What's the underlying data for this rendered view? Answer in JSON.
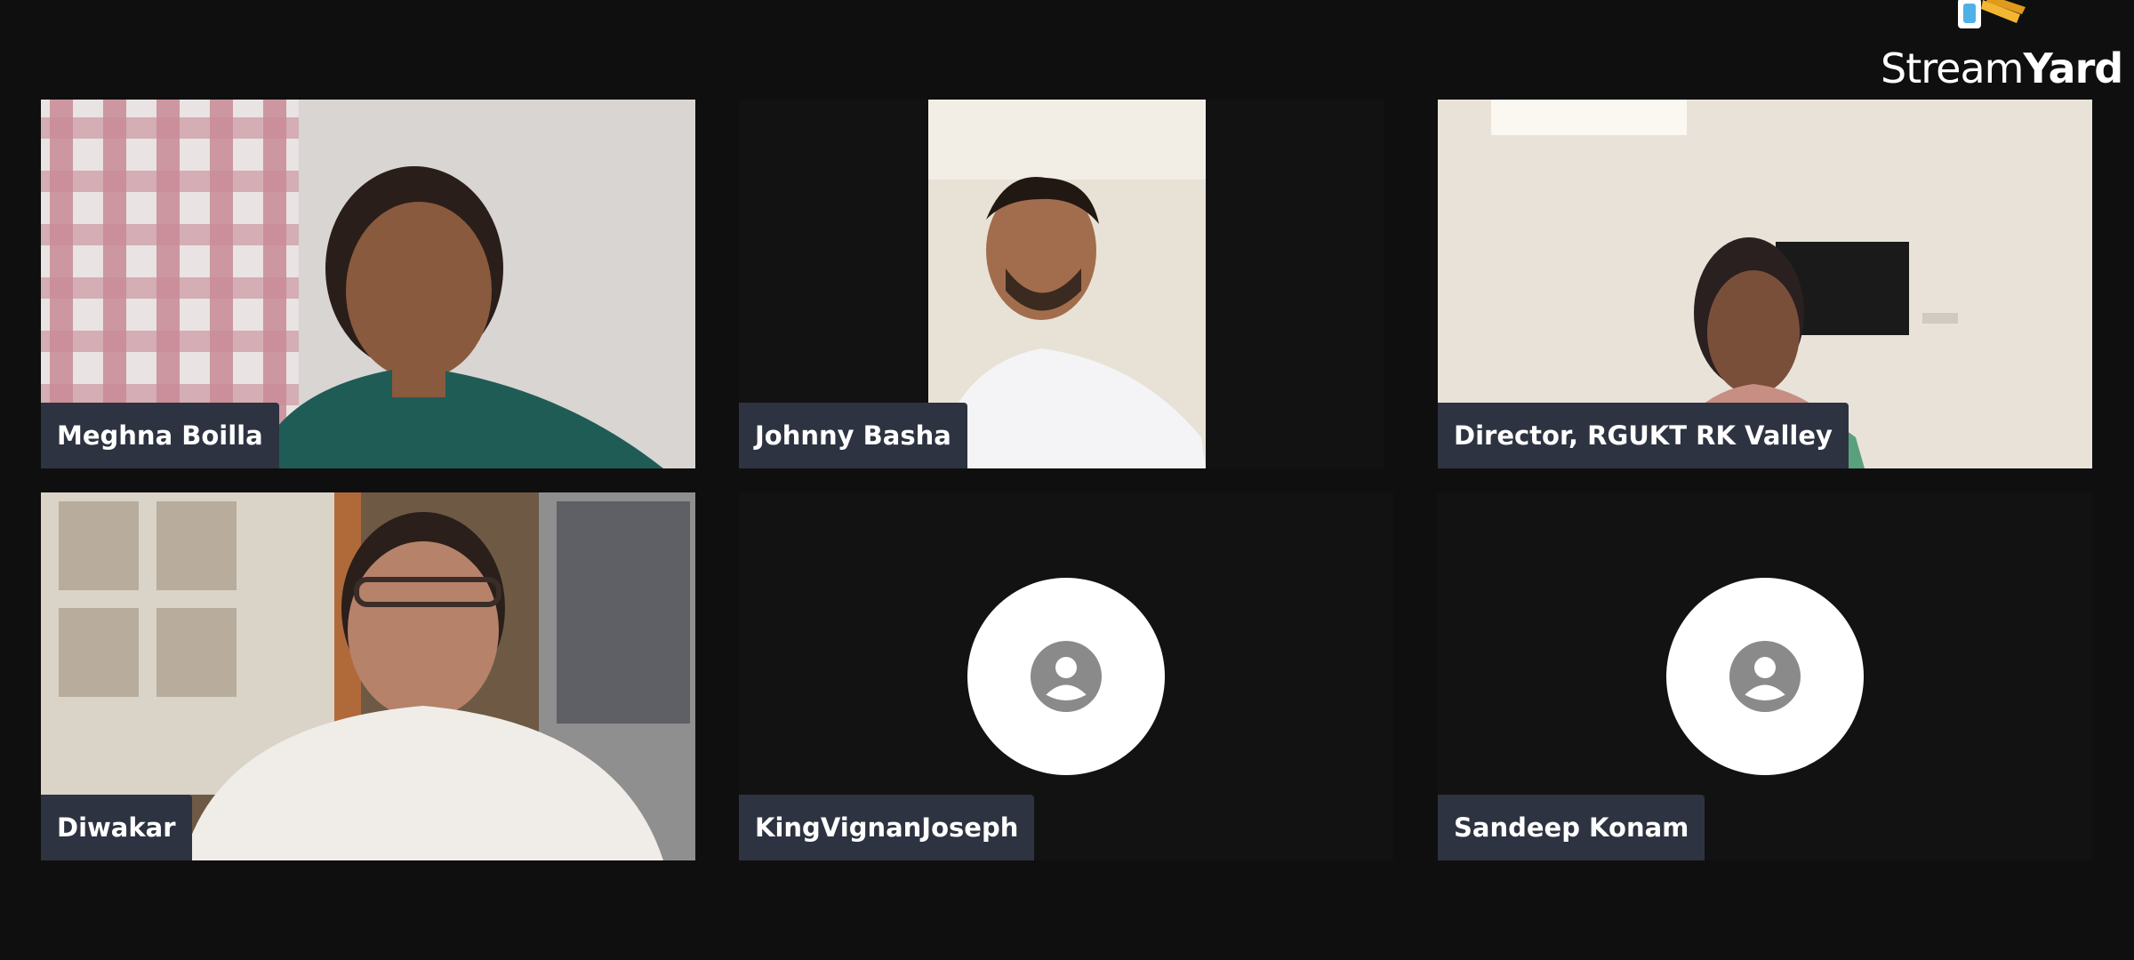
{
  "brand": {
    "name_regular": "Stream",
    "name_bold": "Yard",
    "logo_icon": "streamyard-logo-icon"
  },
  "participants": [
    {
      "name": "Meghna Boilla",
      "video": "on"
    },
    {
      "name": "Johnny Basha",
      "video": "on"
    },
    {
      "name": "Director, RGUKT RK Valley",
      "video": "on"
    },
    {
      "name": "Diwakar",
      "video": "on"
    },
    {
      "name": "KingVignanJoseph",
      "video": "off",
      "icon": "person-avatar-icon"
    },
    {
      "name": "Sandeep Konam",
      "video": "off",
      "icon": "person-avatar-icon"
    }
  ],
  "colors": {
    "background": "#0f0f0f",
    "nameplate": "#2d3340",
    "avatar_circle": "#ffffff",
    "avatar_glyph": "#8a8a8a",
    "brand_accent_blue": "#4fb0e8",
    "brand_accent_yellow": "#f2b632"
  }
}
